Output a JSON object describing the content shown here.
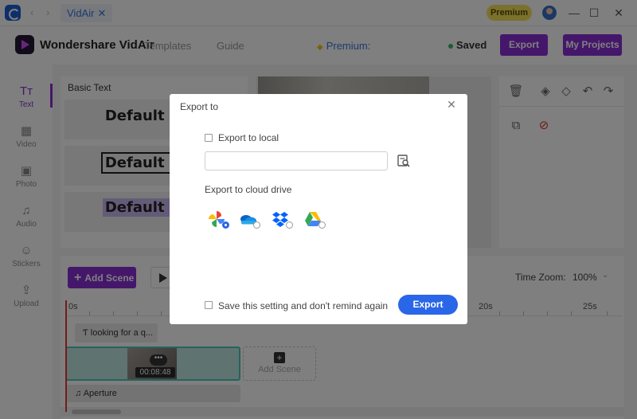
{
  "titlebar": {
    "tab_label": "VidAir",
    "tab_close": "✕",
    "premium_badge": "Premium",
    "minimize": "—",
    "maximize": "☐",
    "close": "✕",
    "nav_arrows": "‹ ›"
  },
  "header": {
    "brand": "Wondershare VidAir",
    "templates": "Templates",
    "guide": "Guide",
    "premium_label": "Premium:",
    "saved": "Saved",
    "export": "Export",
    "my_projects": "My Projects"
  },
  "sidebar": {
    "items": [
      {
        "label": "Text",
        "icon": "text-icon"
      },
      {
        "label": "Video",
        "icon": "film-icon"
      },
      {
        "label": "Photo",
        "icon": "image-icon"
      },
      {
        "label": "Audio",
        "icon": "music-icon"
      },
      {
        "label": "Stickers",
        "icon": "smiley-icon"
      },
      {
        "label": "Upload",
        "icon": "upload-icon"
      }
    ],
    "active": "Text"
  },
  "text_panel": {
    "title": "Basic Text",
    "cards": [
      "Default Text",
      "Default Text",
      "Default Text"
    ]
  },
  "timeline": {
    "add_scene": "Add Scene",
    "time_zoom_label": "Time Zoom:",
    "time_zoom_value": "100%",
    "ruler_labels": [
      "0s",
      "20s",
      "25s"
    ],
    "text_clip": "looking for a q...",
    "video_duration": "00:08:48",
    "add_scene_slot": "Add Scene",
    "audio_clip": "Aperture"
  },
  "modal": {
    "title": "Export to",
    "export_local_label": "Export to local",
    "export_local_checked": false,
    "path_value": "",
    "cloud_label": "Export to cloud drive",
    "cloud_drives": [
      "google-photos-icon",
      "onedrive-icon",
      "dropbox-icon",
      "google-drive-icon"
    ],
    "selected_drive": "google-photos-icon",
    "remember_label": "Save this setting and don't remind again",
    "remember_checked": false,
    "export_button": "Export"
  },
  "colors": {
    "accent_purple": "#8a2fd6",
    "accent_blue": "#2a66e8",
    "premium_yellow": "#f6e35a",
    "saved_green": "#38b46b"
  }
}
